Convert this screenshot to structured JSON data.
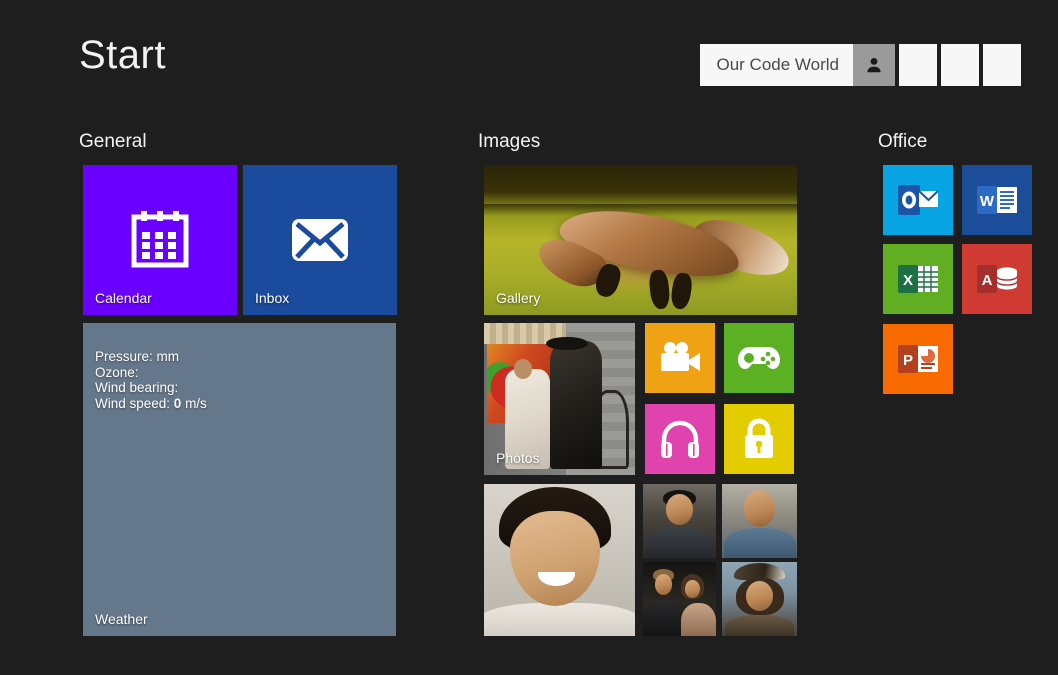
{
  "header": {
    "title": "Start",
    "account_name": "Our Code World",
    "user_icon": "person-icon",
    "blank_buttons": [
      "",
      "",
      ""
    ]
  },
  "colors": {
    "background": "#1e1e1e",
    "calendar": "#6a00ff",
    "inbox": "#1a4b9c",
    "weather": "#65778a",
    "video": "#efa214",
    "games": "#5cb023",
    "music": "#e043ad",
    "lock": "#e3cc00",
    "outlook": "#07a5e3",
    "word": "#1b4d9b",
    "excel": "#61ae22",
    "access": "#cf3a33",
    "powerpoint": "#f76b00",
    "text": "#ffffff"
  },
  "sections": {
    "general": {
      "title": "General",
      "tiles": {
        "calendar": {
          "label": "Calendar",
          "icon": "calendar-icon"
        },
        "inbox": {
          "label": "Inbox",
          "icon": "envelope-icon"
        },
        "weather": {
          "label": "Weather",
          "lines": [
            {
              "text": "Pressure: mm"
            },
            {
              "text": "Ozone:"
            },
            {
              "text": "Wind bearing:"
            }
          ],
          "wind_speed_prefix": "Wind speed: ",
          "wind_speed_value": "0",
          "wind_speed_unit": " m/s"
        }
      }
    },
    "images": {
      "title": "Images",
      "tiles": {
        "gallery": {
          "label": "Gallery",
          "image": "fox-leaping-in-field-photo"
        },
        "photos": {
          "label": "Photos",
          "image": "man-seated-beside-bronze-statue-photo"
        },
        "video": {
          "label": "",
          "icon": "video-camera-icon"
        },
        "games": {
          "label": "",
          "icon": "game-controller-icon"
        },
        "music": {
          "label": "",
          "icon": "headphones-icon"
        },
        "lock": {
          "label": "",
          "icon": "padlock-icon"
        },
        "portrait_main": {
          "label": "",
          "image": "smiling-man-portrait-photo"
        },
        "thumbnails": [
          {
            "label": "",
            "image": "man-in-suit-portrait-photo"
          },
          {
            "label": "",
            "image": "bald-man-in-blue-shirt-photo"
          },
          {
            "label": "",
            "image": "couple-on-red-carpet-photo"
          },
          {
            "label": "",
            "image": "pirate-character-portrait-photo"
          }
        ]
      }
    },
    "office": {
      "title": "Office",
      "tiles": [
        {
          "name": "outlook",
          "letter": "O",
          "icon": "outlook-icon",
          "label": ""
        },
        {
          "name": "word",
          "letter": "W",
          "icon": "word-icon",
          "label": ""
        },
        {
          "name": "excel",
          "letter": "X",
          "icon": "excel-icon",
          "label": ""
        },
        {
          "name": "access",
          "letter": "A",
          "icon": "access-icon",
          "label": ""
        },
        {
          "name": "powerpoint",
          "letter": "P",
          "icon": "powerpoint-icon",
          "label": ""
        }
      ]
    }
  }
}
